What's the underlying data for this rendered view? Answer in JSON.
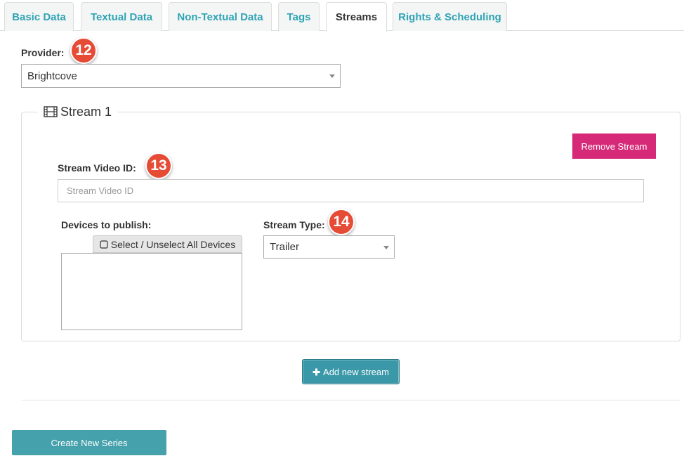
{
  "tabs": [
    {
      "label": "Basic Data",
      "active": false
    },
    {
      "label": "Textual Data",
      "active": false
    },
    {
      "label": "Non-Textual Data",
      "active": false
    },
    {
      "label": "Tags",
      "active": false
    },
    {
      "label": "Streams",
      "active": true
    },
    {
      "label": "Rights & Scheduling",
      "active": false
    }
  ],
  "provider": {
    "label": "Provider:",
    "value": "Brightcove",
    "badge": "12"
  },
  "stream": {
    "legend": "Stream 1",
    "legend_icon": "film-icon",
    "remove_label": "Remove Stream",
    "video_id_label": "Stream Video ID:",
    "video_id_placeholder": "Stream Video ID",
    "video_id_value": "",
    "video_id_badge": "13",
    "devices_label": "Devices to publish:",
    "select_all_label": "Select / Unselect All Devices",
    "select_all_icon": "checkbox-icon",
    "devices": [],
    "stream_type_label": "Stream Type:",
    "stream_type_value": "Trailer",
    "stream_type_badge": "14"
  },
  "add_stream": {
    "label": "Add new stream",
    "icon": "plus-icon"
  },
  "create_series_label": "Create New Series",
  "colors": {
    "tab_text": "#2fa4b5",
    "badge": "#e64b35",
    "remove_button": "#d62a78",
    "add_button": "#3a98a8",
    "create_button": "#45a1ab"
  }
}
